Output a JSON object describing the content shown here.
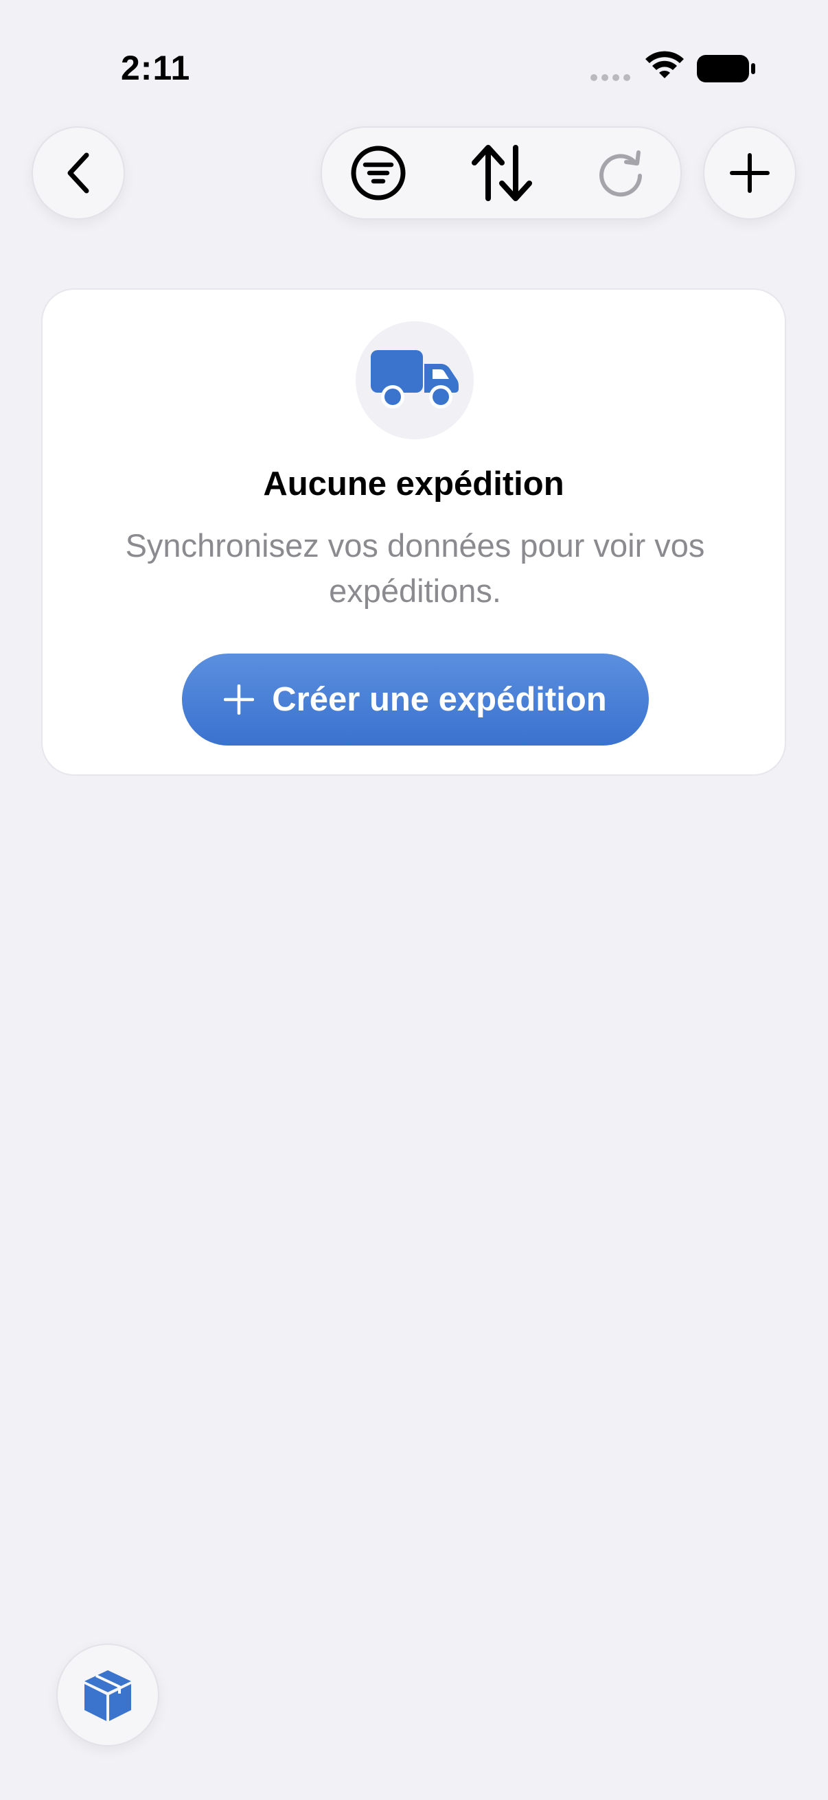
{
  "status_bar": {
    "time": "2:11"
  },
  "toolbar": {
    "back_icon": "chevron-left-icon",
    "filter_icon": "filter-circle-icon",
    "sort_icon": "sort-arrows-icon",
    "refresh_icon": "refresh-icon",
    "add_icon": "plus-icon"
  },
  "empty_state": {
    "icon": "truck-icon",
    "title": "Aucune expédition",
    "message": "Synchronisez vos données pour voir vos expéditions.",
    "button_label": "Créer une expédition"
  },
  "bottom": {
    "icon": "cube-icon"
  },
  "colors": {
    "accent": "#3a72cf",
    "background": "#f1f1f6",
    "secondary_text": "#8a8a8f"
  }
}
